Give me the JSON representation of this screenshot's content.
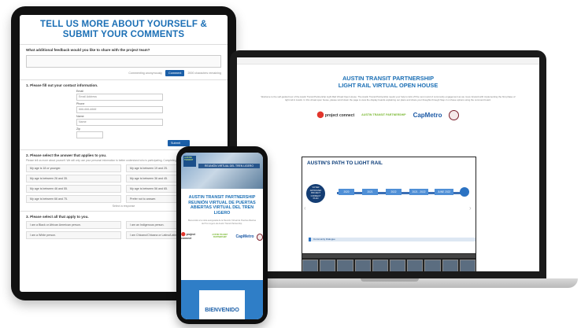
{
  "tablet": {
    "title": "TELL US MORE ABOUT YOURSELF & SUBMIT YOUR COMMENTS",
    "feedback_question": "What additional feedback would you like to share with the project team?",
    "commenting_as": "Commenting anonymously",
    "comment_button": "Comment",
    "chars_remaining": "2000 characters remaining",
    "contact_heading": "1. Please fill out your contact information.",
    "email_label": "Email",
    "email_placeholder": "Email Address",
    "phone_label": "Phone",
    "phone_placeholder": "###-###-####",
    "name_label": "Name",
    "name_placeholder": "Name",
    "zip_label": "Zip",
    "submit_button": "Submit",
    "age_heading": "2. Please select the answer that applies to you.",
    "age_intro": "Please tell us more about yourself. We will only use your personal information to better understand who is participating. Completing this section is optional.",
    "age_options": [
      "My age is 18 or younger.",
      "My age is between 19 and 25.",
      "My age is between 26 and 35.",
      "My age is between 36 and 45.",
      "My age is between 46 and 55.",
      "My age is between 56 and 65.",
      "My age is between 66 and 75.",
      "Prefer not to answer."
    ],
    "select_response": "Select a response",
    "ethnicity_heading": "3. Please select all that apply to you.",
    "ethnicity_options": [
      "I am a Black or African American person.",
      "I am an Indigenous person.",
      "I am a White person.",
      "I am Chicano/Chicana or Latino/Latina"
    ]
  },
  "laptop": {
    "title_line1": "AUSTIN TRANSIT PARTNERSHIP",
    "title_line2": "LIGHT RAIL VIRTUAL OPEN HOUSE",
    "intro": "Welcome to the self-guided tour of the Austin Transit Partnership Light Rail Virtual Open House. The Austin Transit Partnership needs your help to kick off the next round of community engagement as we move forward with implementing the first phase of light rail in Austin. In this virtual open house, please scroll down the page to view the display boards explaining our plans and share your thoughts through Step 2 on these options using the comment board.",
    "logos": {
      "project_connect": "project connect",
      "austin_transit": "AUSTIN TRANSIT PARTNERSHIP",
      "capmetro": "CapMetro"
    },
    "slide": {
      "title": "AUSTIN'S PATH TO LIGHT RAIL",
      "start_label": "VOTER APPROVED PROJECT CONNECT PLAN",
      "milestones": [
        "2020",
        "2021",
        "2022",
        "2021 - 2022",
        "JUNE 2022"
      ],
      "community_dialogue": "Community Dialogue"
    }
  },
  "phone": {
    "hero_logo": "AUSTIN TRANSIT",
    "hero_caption": "REUNIÓN VIRTUAL DEL TREN LIGERO",
    "title": "AUSTIN TRANSIT PARTNERSHIP REUNIÓN VIRTUAL DE PUERTAS ABIERTAS VIRTUAL DEL TREN LIGERO",
    "para": "Bienvenido a la visita autoguiada de la Reunión Virtual de Puertas Abiertas del Tren Ligero de Austin Transit Partnership.",
    "bienvenido": "BIENVENIDO"
  }
}
